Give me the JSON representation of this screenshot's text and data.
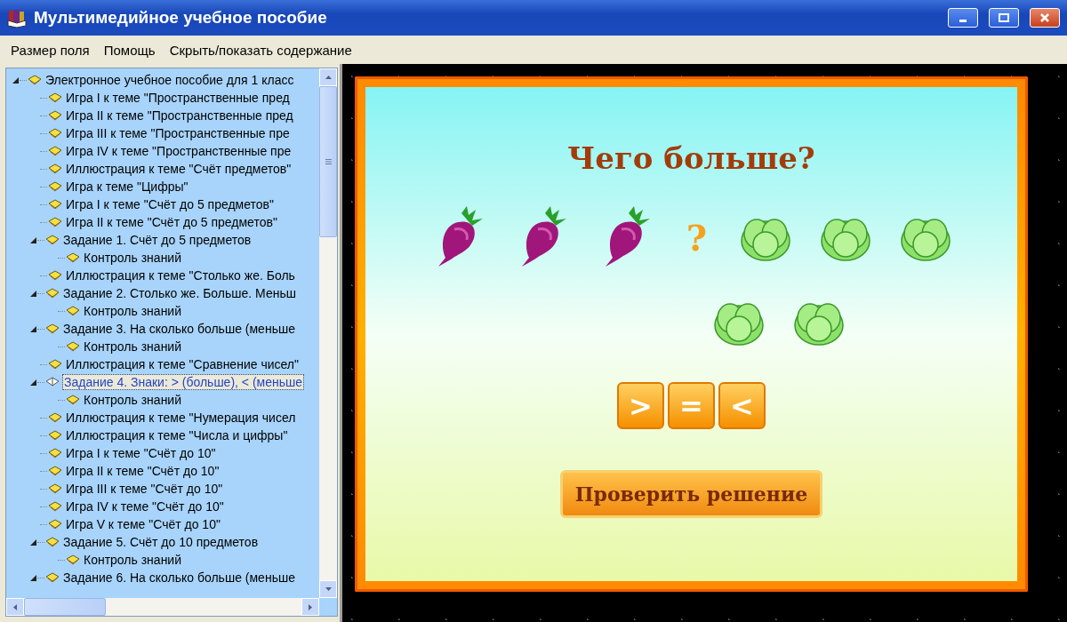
{
  "window": {
    "title": "Мультимедийное учебное пособие"
  },
  "menu": [
    "Размер поля",
    "Помощь",
    "Скрыть/показать содержание"
  ],
  "tree": [
    {
      "label": "Электронное учебное пособие для 1 класс",
      "expanded": true,
      "selected": false,
      "children": [
        {
          "label": "Игра I к теме \"Пространственные пред",
          "selected": false
        },
        {
          "label": "Игра II к теме \"Пространственные пред",
          "selected": false
        },
        {
          "label": "Игра III к теме \"Пространственные пре",
          "selected": false
        },
        {
          "label": "Игра IV к теме \"Пространственные пре",
          "selected": false
        },
        {
          "label": "Иллюстрация к теме \"Счёт предметов\"",
          "selected": false
        },
        {
          "label": "Игра к теме \"Цифры\"",
          "selected": false
        },
        {
          "label": "Игра I к теме \"Счёт до 5 предметов\"",
          "selected": false
        },
        {
          "label": "Игра II к теме \"Счёт до 5 предметов\"",
          "selected": false
        },
        {
          "label": "Задание 1. Счёт до 5 предметов",
          "expanded": true,
          "selected": false,
          "children": [
            {
              "label": "Контроль знаний",
              "selected": false
            }
          ]
        },
        {
          "label": "Иллюстрация к теме \"Столько же. Боль",
          "selected": false
        },
        {
          "label": "Задание 2. Столько же. Больше. Меньш",
          "expanded": true,
          "selected": false,
          "children": [
            {
              "label": "Контроль знаний",
              "selected": false
            }
          ]
        },
        {
          "label": "Задание 3. На сколько больше (меньше",
          "expanded": true,
          "selected": false,
          "children": [
            {
              "label": "Контроль знаний",
              "selected": false
            }
          ]
        },
        {
          "label": "Иллюстрация к теме \"Сравнение чисел\"",
          "selected": false
        },
        {
          "label": "Задание 4. Знаки: > (больше), < (меньше",
          "expanded": true,
          "selected": true,
          "children": [
            {
              "label": "Контроль знаний",
              "selected": false
            }
          ]
        },
        {
          "label": "Иллюстрация к теме \"Нумерация чисел",
          "selected": false
        },
        {
          "label": "Иллюстрация к теме \"Числа и цифры\"",
          "selected": false
        },
        {
          "label": "Игра I к теме \"Счёт до 10\"",
          "selected": false
        },
        {
          "label": "Игра II к теме \"Счёт до 10\"",
          "selected": false
        },
        {
          "label": "Игра III к теме \"Счёт до 10\"",
          "selected": false
        },
        {
          "label": "Игра IV к теме \"Счёт до 10\"",
          "selected": false
        },
        {
          "label": "Игра V к теме \"Счёт до 10\"",
          "selected": false
        },
        {
          "label": "Задание 5. Счёт до 10 предметов",
          "expanded": true,
          "selected": false,
          "children": [
            {
              "label": "Контроль знаний",
              "selected": false
            }
          ]
        },
        {
          "label": "Задание 6. На сколько больше (меньше",
          "expanded": true,
          "selected": false
        }
      ]
    }
  ],
  "game": {
    "title": "Чего больше?",
    "top_row": [
      {
        "kind": "beet"
      },
      {
        "kind": "beet"
      },
      {
        "kind": "beet"
      },
      {
        "kind": "question",
        "text": "?"
      },
      {
        "kind": "cabbage"
      },
      {
        "kind": "cabbage"
      },
      {
        "kind": "cabbage"
      }
    ],
    "bottom_row": [
      {
        "kind": "cabbage"
      },
      {
        "kind": "cabbage"
      }
    ],
    "sign_buttons": [
      ">",
      "=",
      "<"
    ],
    "check_button": "Проверить решение"
  }
}
